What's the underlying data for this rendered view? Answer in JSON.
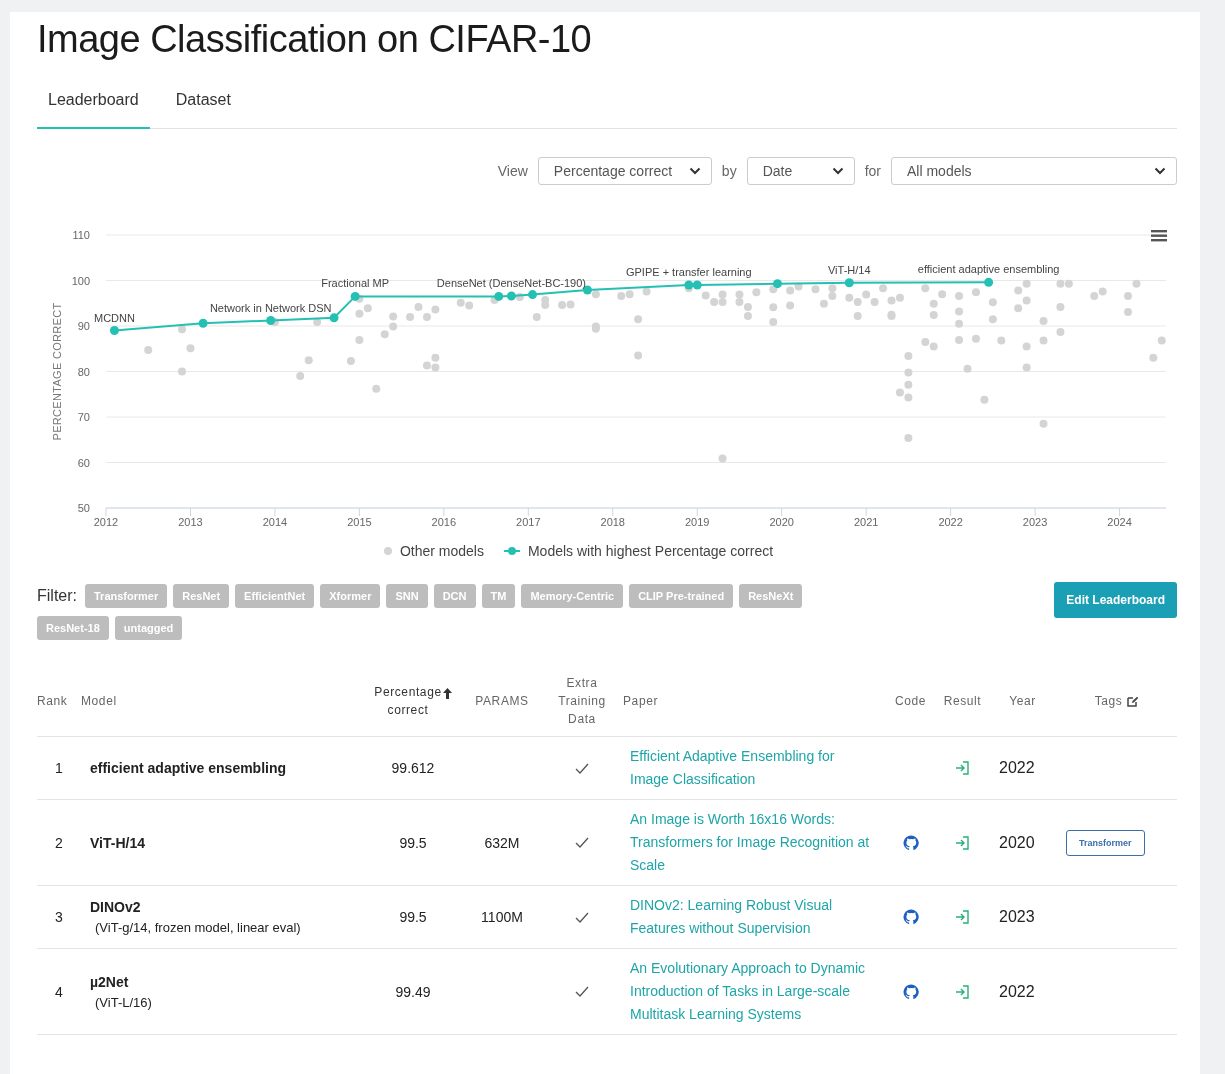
{
  "page": {
    "title": "Image Classification on CIFAR-10"
  },
  "tabs": [
    {
      "label": "Leaderboard",
      "selected": true
    },
    {
      "label": "Dataset",
      "selected": false
    }
  ],
  "view_controls": {
    "view_label": "View",
    "metric": "Percentage correct",
    "by_label": "by",
    "x_axis": "Date",
    "for_label": "for",
    "models": "All models"
  },
  "chart": {
    "chart_data": {
      "type": "scatter",
      "ylabel": "PERCENTAGE CORRECT",
      "xlim": [
        2012,
        2024.55
      ],
      "ylim": [
        50,
        110
      ],
      "xticks": [
        2012,
        2013,
        2014,
        2015,
        2016,
        2017,
        2018,
        2019,
        2020,
        2021,
        2022,
        2023,
        2024
      ],
      "yticks": [
        50,
        60,
        70,
        80,
        90,
        100,
        110
      ],
      "series": [
        {
          "name": "Other models",
          "type": "scatter",
          "color": "#d4d4d4",
          "x": [
            2012.5,
            2012.9,
            2012.9,
            2013.0,
            2014.0,
            2014.3,
            2014.4,
            2014.5,
            2014.9,
            2015.0,
            2015.0,
            2015.0,
            2015.1,
            2015.2,
            2015.3,
            2015.4,
            2015.4,
            2015.6,
            2015.7,
            2015.8,
            2015.9,
            2015.9,
            2015.9,
            2015.8,
            2016.2,
            2016.3,
            2016.6,
            2016.9,
            2017.1,
            2017.2,
            2017.2,
            2017.4,
            2017.5,
            2017.8,
            2017.8,
            2017.8,
            2018.1,
            2018.2,
            2018.3,
            2018.3,
            2018.4,
            2018.9,
            2019.1,
            2019.2,
            2019.3,
            2019.3,
            2019.3,
            2019.5,
            2019.5,
            2019.6,
            2019.6,
            2019.7,
            2019.9,
            2019.9,
            2019.9,
            2020.1,
            2020.1,
            2020.2,
            2020.4,
            2020.5,
            2020.6,
            2020.6,
            2020.8,
            2020.9,
            2020.9,
            2021.0,
            2021.1,
            2021.2,
            2021.3,
            2021.3,
            2021.3,
            2021.4,
            2021.5,
            2021.5,
            2021.5,
            2021.4,
            2021.5,
            2021.5,
            2021.7,
            2021.8,
            2021.7,
            2021.8,
            2021.8,
            2021.9,
            2022.1,
            2022.1,
            2022.1,
            2022.1,
            2022.2,
            2022.3,
            2022.3,
            2022.4,
            2022.5,
            2022.5,
            2022.6,
            2022.8,
            2022.8,
            2022.9,
            2022.9,
            2022.9,
            2022.9,
            2023.1,
            2023.1,
            2023.1,
            2023.3,
            2023.3,
            2023.3,
            2023.4,
            2023.7,
            2023.8,
            2024.1,
            2024.1,
            2024.2,
            2024.4,
            2024.5
          ],
          "values": [
            84.7,
            89.3,
            80,
            85.1,
            90.9,
            79,
            82.5,
            90.9,
            82.3,
            86.9,
            92.7,
            96,
            93.9,
            76.2,
            88.2,
            89.9,
            92.1,
            92,
            94.2,
            81.3,
            83,
            80.9,
            93.6,
            92,
            95.1,
            94.5,
            95.7,
            96.4,
            92,
            95.7,
            94.6,
            94.6,
            94.7,
            89.4,
            89.9,
            97,
            96.6,
            97,
            91.5,
            83.5,
            97.6,
            98.3,
            96.7,
            95.3,
            60.9,
            96.9,
            95.3,
            96.9,
            95.3,
            94.2,
            92.2,
            97.4,
            94.1,
            90.9,
            98.1,
            94.5,
            97.8,
            98.7,
            98.1,
            94.9,
            96.6,
            98.3,
            96.2,
            92.2,
            95.3,
            96.9,
            95.3,
            98.3,
            95.6,
            92.2,
            92.5,
            96.2,
            83.4,
            79.8,
            77.1,
            75.4,
            74.3,
            65.4,
            86.5,
            85.5,
            98.3,
            94.9,
            92.4,
            97,
            86.9,
            96.6,
            93.2,
            90.5,
            80.6,
            87.2,
            97.4,
            73.8,
            95.2,
            91.5,
            86.8,
            97.8,
            93.9,
            85.5,
            95.6,
            80.9,
            99.3,
            91.1,
            86.8,
            68.5,
            88.7,
            94.2,
            99.3,
            99.3,
            96.6,
            97.6,
            96.6,
            93.1,
            99.3,
            83,
            86.8
          ]
        },
        {
          "name": "Models with highest Percentage correct",
          "type": "line",
          "color": "#25c0b4",
          "x": [
            2012.1,
            2013.15,
            2013.95,
            2014.7,
            2014.95,
            2016.65,
            2016.8,
            2017.05,
            2017.7,
            2018.9,
            2019.0,
            2019.95,
            2020.8,
            2022.45
          ],
          "values": [
            89,
            90.6,
            91.2,
            91.8,
            96.5,
            96.5,
            96.6,
            96.9,
            97.9,
            99.0,
            99.0,
            99.3,
            99.5,
            99.6
          ],
          "marker": "circle"
        }
      ],
      "grid": true,
      "legend": true,
      "annotations": [
        {
          "x": 2012.1,
          "y": 89,
          "text": "MCDNN"
        },
        {
          "x": 2013.95,
          "y": 91.2,
          "text": "Network in Network DSN"
        },
        {
          "x": 2014.95,
          "y": 96.5,
          "text": "Fractional MP"
        },
        {
          "x": 2016.8,
          "y": 96.6,
          "text": "DenseNet (DenseNet-BC-190)"
        },
        {
          "x": 2018.9,
          "y": 99.0,
          "text": "GPIPE + transfer learning"
        },
        {
          "x": 2020.8,
          "y": 99.5,
          "text": "ViT-H/14"
        },
        {
          "x": 2022.45,
          "y": 99.6,
          "text": "efficient adaptive ensembling"
        }
      ]
    }
  },
  "filter": {
    "label": "Filter:",
    "tags": [
      "Transformer",
      "ResNet",
      "EfficientNet",
      "Xformer",
      "SNN",
      "DCN",
      "TM",
      "Memory-Centric",
      "CLIP Pre-trained",
      "ResNeXt",
      "ResNet-18",
      "untagged"
    ]
  },
  "edit_button": "Edit Leaderboard",
  "table": {
    "columns": [
      {
        "label": "Rank",
        "sorted": false,
        "editable": false
      },
      {
        "label": "Model",
        "sorted": false,
        "editable": false
      },
      {
        "label": "Percentage correct",
        "sorted": true,
        "editable": false
      },
      {
        "label": "PARAMS",
        "sorted": false,
        "editable": false
      },
      {
        "label": "Extra Training Data",
        "sorted": false,
        "editable": false
      },
      {
        "label": "Paper",
        "sorted": false,
        "editable": false
      },
      {
        "label": "Code",
        "sorted": false,
        "editable": false
      },
      {
        "label": "Result",
        "sorted": false,
        "editable": false
      },
      {
        "label": "Year",
        "sorted": false,
        "editable": false
      },
      {
        "label": "Tags",
        "sorted": false,
        "editable": true
      }
    ],
    "rows": [
      {
        "rank": "1",
        "model": "efficient adaptive ensembling",
        "percentage": "99.612",
        "extra_training_data": true,
        "paper": "Efficient Adaptive Ensembling for Image Classification",
        "has_code": false,
        "year": "2022",
        "tags": []
      },
      {
        "rank": "2",
        "model": "ViT-H/14",
        "percentage": "99.5",
        "params": "632M",
        "extra_training_data": true,
        "paper": "An Image is Worth 16x16 Words: Transformers for Image Recognition at Scale",
        "has_code": true,
        "year": "2020",
        "tags": [
          "Transformer"
        ]
      },
      {
        "rank": "3",
        "model": "DINOv2",
        "detail": "(ViT-g/14, frozen model, linear eval)",
        "percentage": "99.5",
        "params": "1100M",
        "extra_training_data": true,
        "paper": "DINOv2: Learning Robust Visual Features without Supervision",
        "has_code": true,
        "year": "2023",
        "tags": []
      },
      {
        "rank": "4",
        "model": "µ2Net",
        "detail": "(ViT-L/16)",
        "percentage": "99.49",
        "extra_training_data": true,
        "paper": "An Evolutionary Approach to Dynamic Introduction of Tasks in Large-scale Multitask Learning Systems",
        "has_code": true,
        "year": "2022",
        "tags": []
      }
    ]
  }
}
